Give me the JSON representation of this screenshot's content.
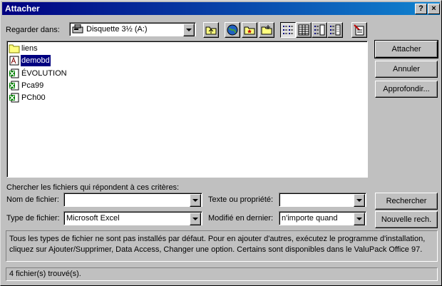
{
  "window": {
    "title": "Attacher",
    "help_btn": "?",
    "close_btn": "×"
  },
  "lookin": {
    "label": "Regarder dans:",
    "value": "Disquette 3½ (A:)"
  },
  "toolbar": [
    {
      "icon": "up-one-level-icon"
    },
    {
      "icon": "search-web-icon"
    },
    {
      "icon": "look-in-favorites-icon"
    },
    {
      "icon": "add-to-favorites-icon"
    },
    {
      "icon": "list-view-icon",
      "pressed": true
    },
    {
      "icon": "details-view-icon"
    },
    {
      "icon": "properties-view-icon"
    },
    {
      "icon": "preview-view-icon"
    },
    {
      "icon": "commands-settings-icon"
    }
  ],
  "files": [
    {
      "name": "liens",
      "type": "folder"
    },
    {
      "name": "demobd",
      "type": "access",
      "selected": true
    },
    {
      "name": "ÉVOLUTION",
      "type": "excel"
    },
    {
      "name": "Pca99",
      "type": "excel"
    },
    {
      "name": "PCh00",
      "type": "excel"
    }
  ],
  "buttons": {
    "attach": "Attacher",
    "cancel": "Annuler",
    "advanced": "Approfondir...",
    "search": "Rechercher",
    "new_search": "Nouvelle rech."
  },
  "criteria": {
    "heading": "Chercher les fichiers qui répondent à ces critères:",
    "filename_label": "Nom de fichier:",
    "filename_value": "",
    "text_label": "Texte ou propriété:",
    "text_value": "",
    "filetype_label": "Type de fichier:",
    "filetype_value": "Microsoft Excel",
    "modified_label": "Modifié en dernier:",
    "modified_value": "n'importe quand"
  },
  "info": "Tous les types de fichier ne sont pas installés par défaut. Pour en ajouter d'autres, exécutez le programme d'installation, cliquez sur Ajouter/Supprimer, Data Access, Changer une option. Certains sont disponibles dans le ValuPack Office 97.",
  "status": "4 fichier(s) trouvé(s)."
}
